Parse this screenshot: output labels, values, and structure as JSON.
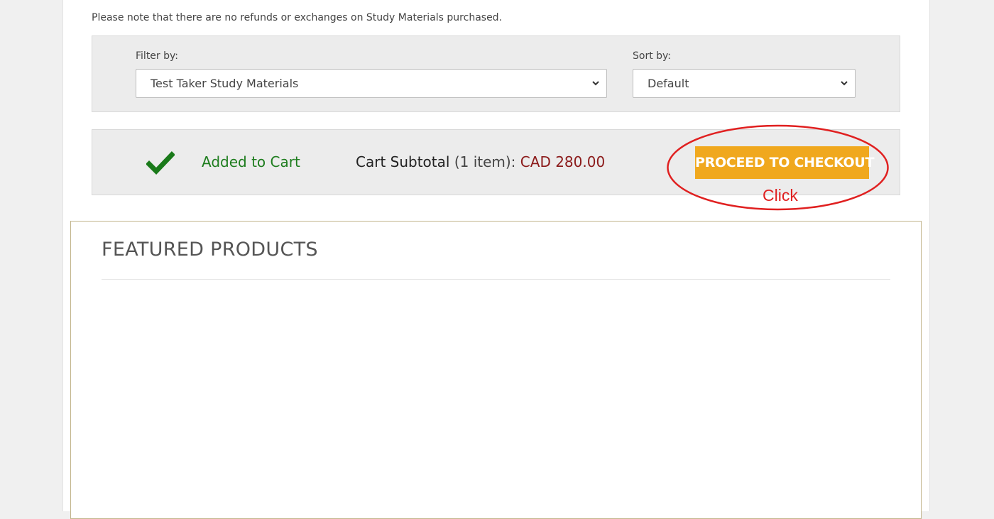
{
  "notice": "Please note that there are no refunds or exchanges on Study Materials purchased.",
  "filters": {
    "filter_label": "Filter by:",
    "filter_value": "Test Taker Study Materials",
    "sort_label": "Sort by:",
    "sort_value": "Default"
  },
  "cart": {
    "added_text": "Added to Cart",
    "subtotal_label": "Cart Subtotal",
    "item_count": "(1 item):",
    "price": "CAD 280.00",
    "checkout_label": "PROCEED TO CHECKOUT"
  },
  "annotation": {
    "click_label": "Click",
    "color": "#e02020"
  },
  "featured": {
    "title": "FEATURED PRODUCTS"
  },
  "colors": {
    "checkout_button": "#f0a81e",
    "added_text": "#1e7d1e",
    "price": "#8b1a1a",
    "panel_bg": "#ececec"
  },
  "icons": {
    "check": "check-icon",
    "chevron": "chevron-down-icon"
  }
}
